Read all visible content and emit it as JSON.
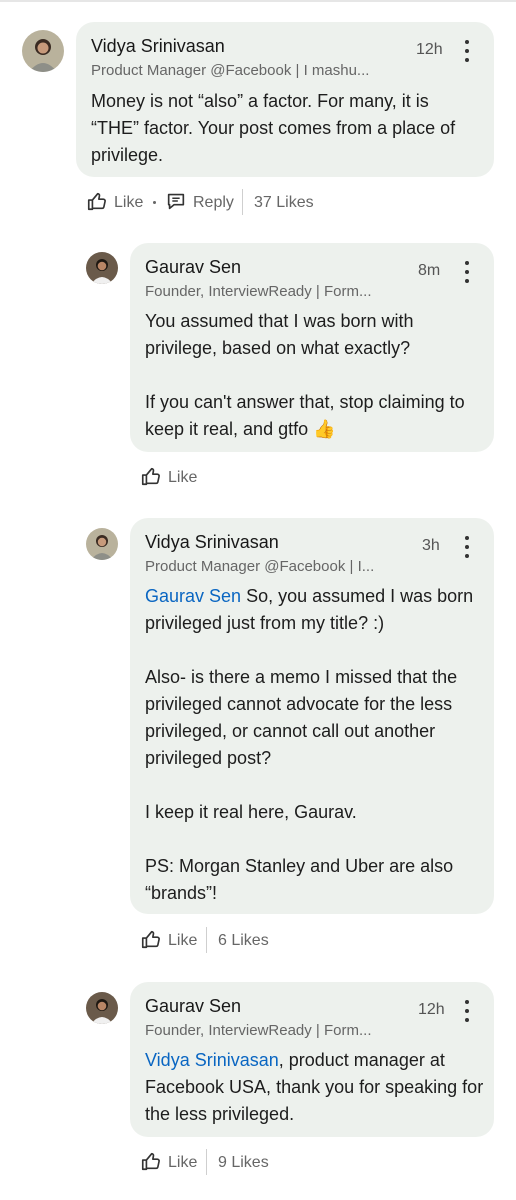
{
  "comments": [
    {
      "author": "Vidya Srinivasan",
      "headline": "Product Manager @Facebook | I mashu...",
      "time": "12h",
      "mention": "",
      "paragraphs": [
        "Money is not “also” a factor. For many, it is “THE” factor. Your post comes from a place of privilege."
      ],
      "actions": {
        "like": "Like",
        "reply": "Reply",
        "likes": "37 Likes"
      }
    },
    {
      "author": "Gaurav Sen",
      "headline": "Founder, InterviewReady | Form...",
      "time": "8m",
      "paragraphs": [
        "You assumed that I was born with privilege, based on what exactly?",
        "If you can't answer that, stop claiming to keep it real, and gtfo 👍"
      ],
      "actions": {
        "like": "Like"
      }
    },
    {
      "author": "Vidya Srinivasan",
      "headline": "Product Manager @Facebook | I...",
      "time": "3h",
      "mention": "Gaurav Sen",
      "first_rest": " So, you assumed I was born privileged just from my title? :)",
      "paragraphs": [
        "Also- is there a memo I missed that the privileged cannot advocate for the less privileged, or cannot call out another privileged post?",
        "I keep it real here, Gaurav.",
        "PS: Morgan Stanley and Uber are also “brands”!"
      ],
      "actions": {
        "like": "Like",
        "likes": "6 Likes"
      }
    },
    {
      "author": "Gaurav Sen",
      "headline": "Founder, InterviewReady | Form...",
      "time": "12h",
      "mention": "Vidya Srinivasan",
      "first_rest": ", product manager at Facebook USA, thank you for speaking for the less privileged.",
      "actions": {
        "like": "Like",
        "likes": "9 Likes"
      }
    }
  ],
  "icons": {
    "like": "thumbs-up-icon",
    "reply": "reply-bubble-icon",
    "more": "more-vertical-icon"
  },
  "colors": {
    "bubble": "#edf1ed",
    "mention": "#0a66c2",
    "meta": "#666666"
  }
}
